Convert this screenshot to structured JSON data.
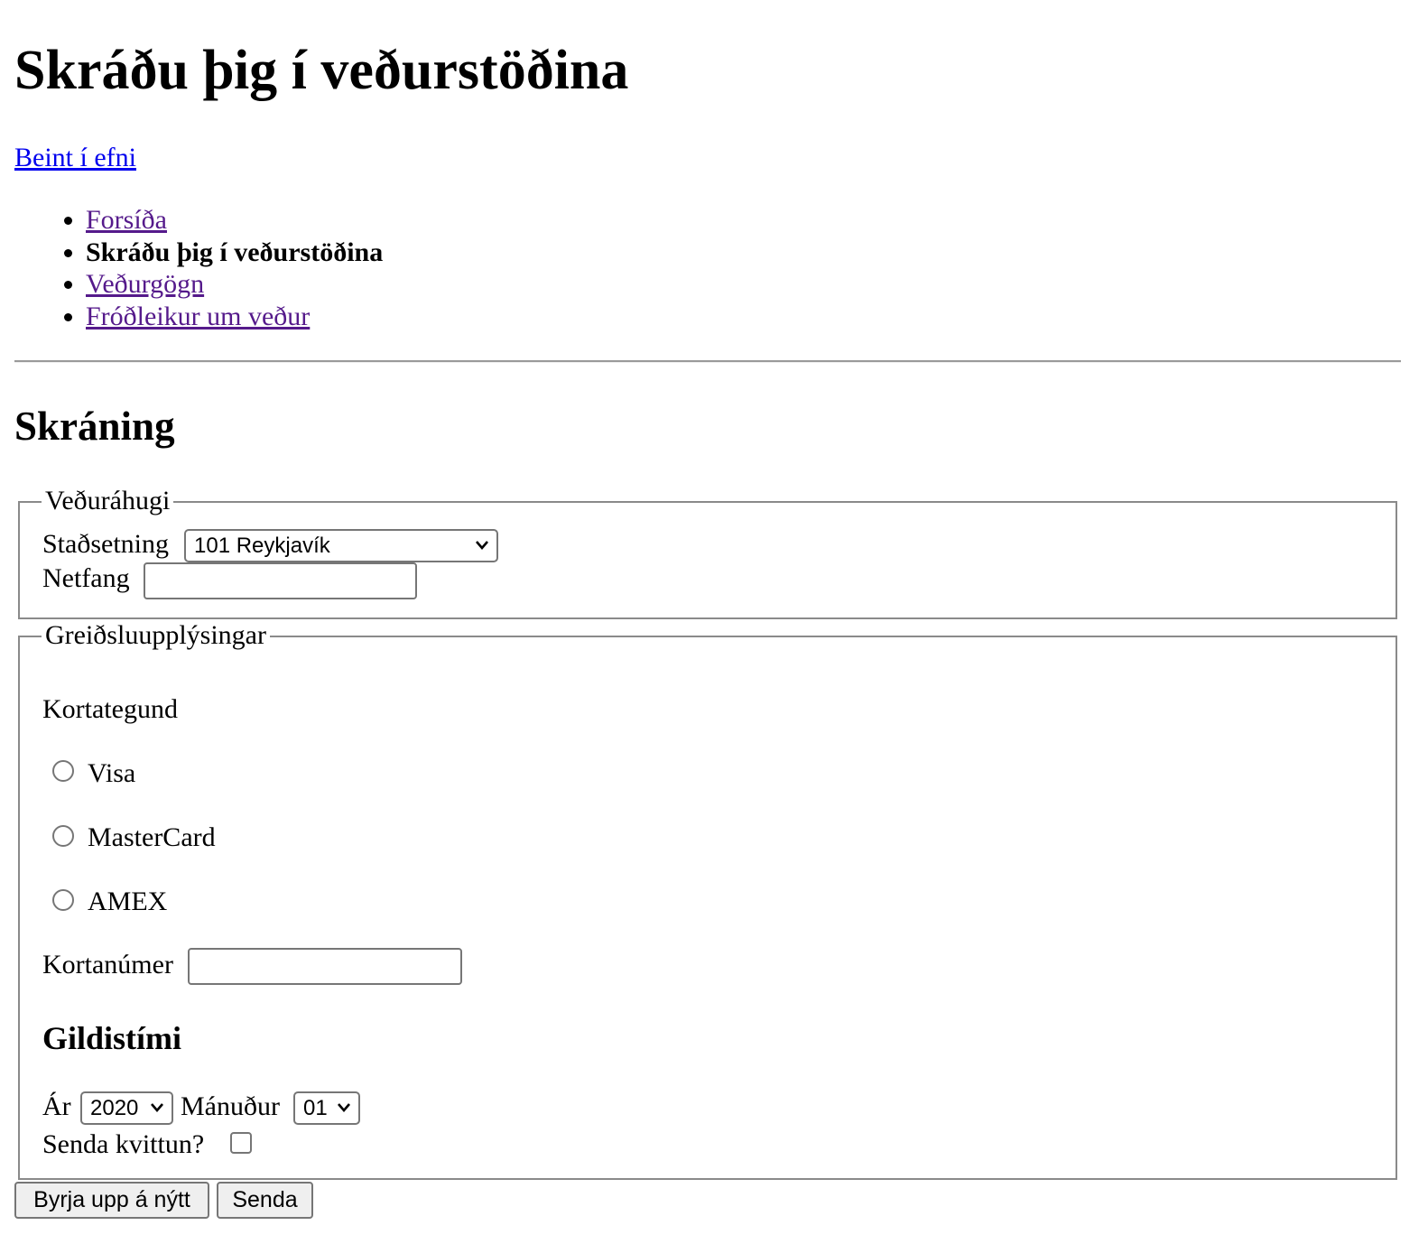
{
  "page_title": "Skráðu þig í veðurstöðina",
  "skip_link": "Beint í efni",
  "nav": {
    "items": [
      {
        "label": "Forsíða",
        "current": false
      },
      {
        "label": "Skráðu þig í veðurstöðina",
        "current": true
      },
      {
        "label": "Veðurgögn",
        "current": false
      },
      {
        "label": "Fróðleikur um veður",
        "current": false
      }
    ]
  },
  "section_title": "Skráning",
  "interest": {
    "legend": "Veðuráhugi",
    "location_label": "Staðsetning",
    "location_value": "101 Reykjavík",
    "email_label": "Netfang",
    "email_value": ""
  },
  "payment": {
    "legend": "Greiðsluupplýsingar",
    "card_type_label": "Kortategund",
    "card_types": [
      "Visa",
      "MasterCard",
      "AMEX"
    ],
    "card_number_label": "Kortanúmer",
    "card_number_value": "",
    "expiry_heading": "Gildistími",
    "year_label": "Ár",
    "year_value": "2020",
    "month_label": "Mánuður",
    "month_value": "01",
    "receipt_label": "Senda kvittun?"
  },
  "buttons": {
    "reset": "Byrja upp á nýtt",
    "submit": "Senda"
  }
}
